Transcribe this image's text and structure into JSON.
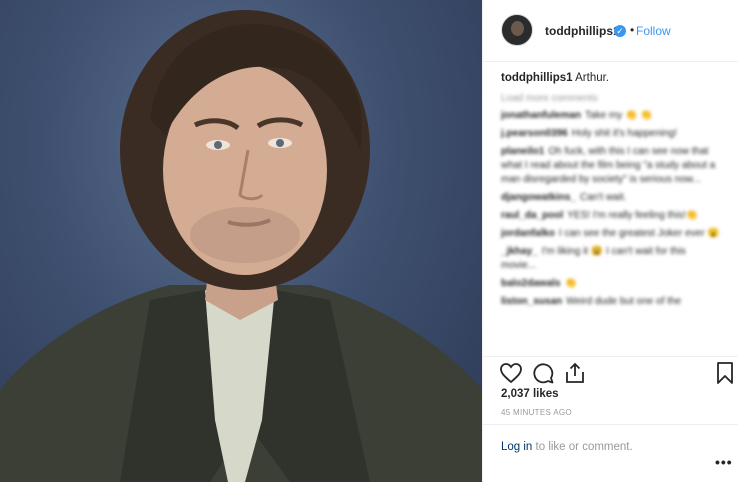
{
  "post": {
    "username": "toddphillips1",
    "verified_glyph": "✓",
    "separator": "•",
    "follow_label": "Follow",
    "caption_user": "toddphillips1",
    "caption_text": "Arthur.",
    "load_more": "Load more comments",
    "comments": [
      {
        "user": "jonathanfuleman",
        "text": "Take my 👏 👏"
      },
      {
        "user": "j.pearson0396",
        "text": "Holy shit it's happening!"
      },
      {
        "user": "planeilo1",
        "text": "Oh fuck, with this I can see now that what I read about the film being \"a study about a man disregarded by society\" is serious now..."
      },
      {
        "user": "djangowatkins_",
        "text": "Can't wait."
      },
      {
        "user": "raul_da_pool",
        "text": "YES! I'm really feeling this!👏"
      },
      {
        "user": "jordanfalko",
        "text": "I can see the greatest Joker ever 😮"
      },
      {
        "user": "_jkhay_",
        "text": "I'm liking it 😫 I can't wait for this movie..."
      },
      {
        "user": "balo2dawals",
        "text": "👏"
      },
      {
        "user": "liston_susan",
        "text": "Weird dude but one of the"
      }
    ],
    "likes": "2,037 likes",
    "time": "45 MINUTES AGO",
    "login_link": "Log in",
    "login_rest": " to like or comment.",
    "more_glyph": "•••"
  },
  "icons": [
    "heart-icon",
    "comment-icon",
    "share-icon",
    "bookmark-icon",
    "verified-badge-icon"
  ],
  "colors": {
    "link": "#3897f0",
    "text": "#262626",
    "muted": "#999999",
    "background_photo": "#3f5070"
  }
}
